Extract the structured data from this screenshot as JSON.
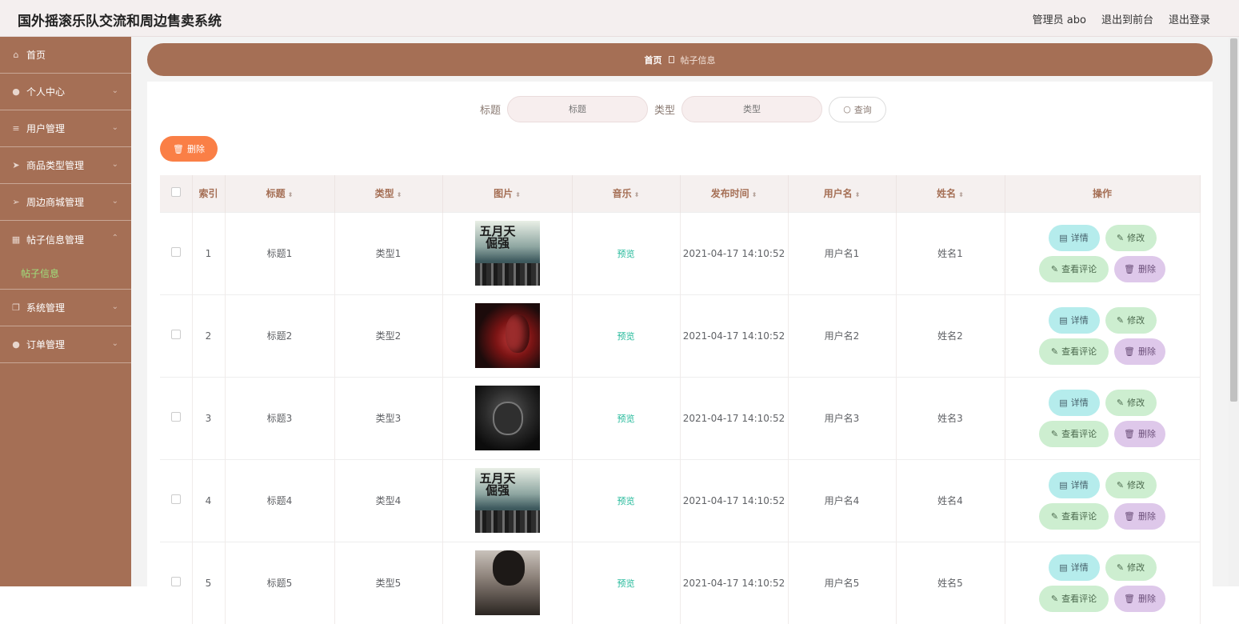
{
  "header": {
    "title": "国外摇滚乐队交流和周边售卖系统",
    "admin": "管理员 abo",
    "to_front": "退出到前台",
    "logout": "退出登录"
  },
  "sidebar": {
    "items": [
      {
        "label": "首页",
        "icon": "home-icon"
      },
      {
        "label": "个人中心",
        "icon": "user-icon"
      },
      {
        "label": "用户管理",
        "icon": "list-icon"
      },
      {
        "label": "商品类型管理",
        "icon": "send-icon"
      },
      {
        "label": "周边商城管理",
        "icon": "send-icon"
      },
      {
        "label": "帖子信息管理",
        "icon": "grid-icon"
      },
      {
        "label": "系统管理",
        "icon": "copy-icon"
      },
      {
        "label": "订单管理",
        "icon": "user-icon"
      }
    ],
    "sub_item": "帖子信息"
  },
  "breadcrumb": {
    "home": "首页",
    "current": "帖子信息"
  },
  "search": {
    "title_label": "标题",
    "title_placeholder": "标题",
    "type_label": "类型",
    "type_placeholder": "类型",
    "query_button": "查询"
  },
  "toolbar": {
    "delete_label": "删除"
  },
  "table": {
    "columns": [
      "索引",
      "标题",
      "类型",
      "图片",
      "音乐",
      "发布时间",
      "用户名",
      "姓名",
      "操作"
    ],
    "rows": [
      {
        "index": "1",
        "title": "标题1",
        "type": "类型1",
        "music": "预览",
        "time": "2021-04-17 14:10:52",
        "username": "用户名1",
        "name": "姓名1"
      },
      {
        "index": "2",
        "title": "标题2",
        "type": "类型2",
        "music": "预览",
        "time": "2021-04-17 14:10:52",
        "username": "用户名2",
        "name": "姓名2"
      },
      {
        "index": "3",
        "title": "标题3",
        "type": "类型3",
        "music": "预览",
        "time": "2021-04-17 14:10:52",
        "username": "用户名3",
        "name": "姓名3"
      },
      {
        "index": "4",
        "title": "标题4",
        "type": "类型4",
        "music": "预览",
        "time": "2021-04-17 14:10:52",
        "username": "用户名4",
        "name": "姓名4"
      },
      {
        "index": "5",
        "title": "标题5",
        "type": "类型5",
        "music": "预览",
        "time": "2021-04-17 14:10:52",
        "username": "用户名5",
        "name": "姓名5"
      }
    ],
    "actions": {
      "detail": "详情",
      "edit": "修改",
      "comment": "查看评论",
      "delete": "删除"
    }
  },
  "colors": {
    "brand": "#a56f55",
    "delete": "#fa7f46",
    "preview": "#23b99a"
  }
}
